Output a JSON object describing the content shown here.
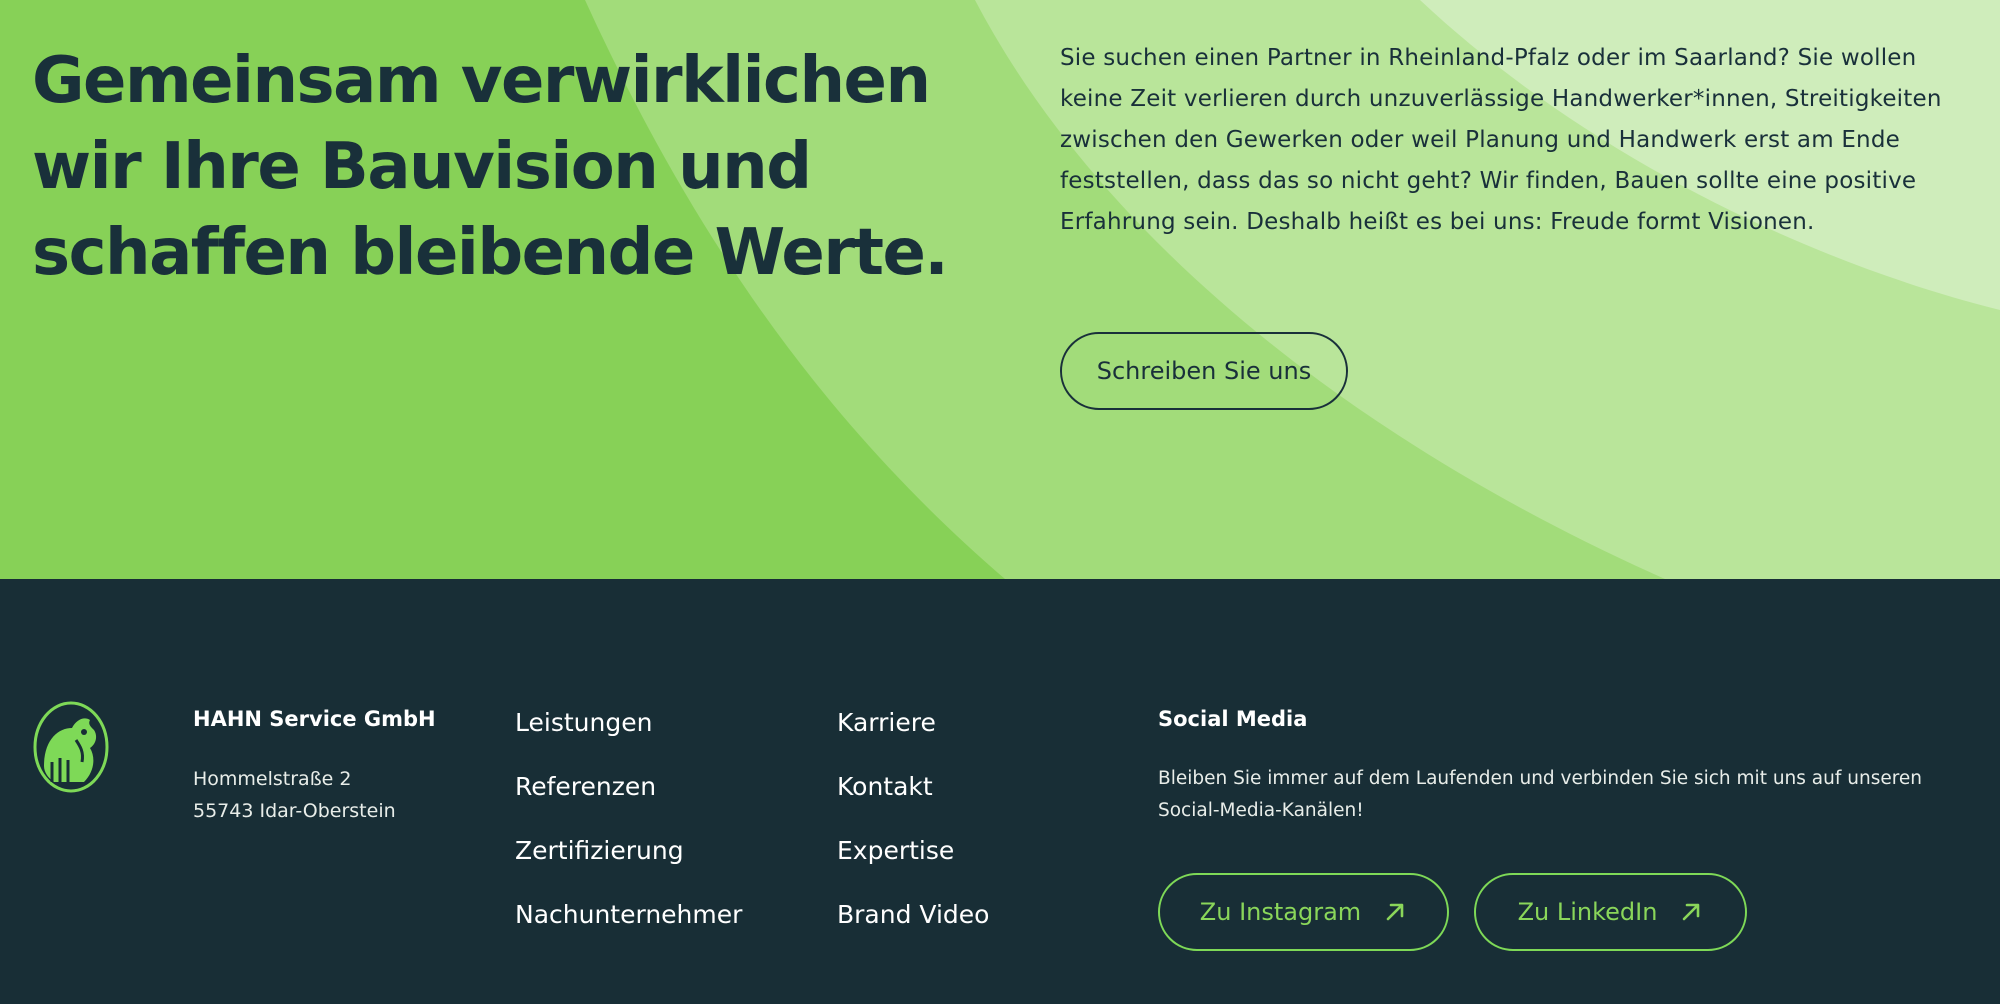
{
  "hero": {
    "title": "Gemeinsam verwirklichen wir Ihre Bauvision und schaffen bleibende Werte.",
    "text": "Sie suchen einen Partner in Rheinland-Pfalz oder im Saarland? Sie wollen keine Zeit verlieren durch unzuverlässige Handwerker*innen, Streitigkeiten zwischen den Gewerken oder weil Planung und Handwerk erst am Ende feststellen, dass das so nicht geht? Wir finden, Bauen sollte eine positive Erfahrung sein. Deshalb heißt es bei uns: Freude formt Visionen.",
    "cta_label": "Schreiben Sie uns"
  },
  "footer": {
    "company": {
      "name": "HAHN Service GmbH",
      "street": "Hommelstraße 2",
      "city": "55743 Idar-Oberstein"
    },
    "nav_col1": [
      "Leistungen",
      "Referenzen",
      "Zertifizierung",
      "Nachunternehmer"
    ],
    "nav_col2": [
      "Karriere",
      "Kontakt",
      "Expertise",
      "Brand Video"
    ],
    "social": {
      "title": "Social Media",
      "text": "Bleiben Sie immer auf dem Laufenden und verbinden Sie sich mit uns auf unseren Social-Media-Kanälen!",
      "instagram_label": "Zu Instagram",
      "linkedin_label": "Zu LinkedIn"
    }
  },
  "colors": {
    "hero_green": "#87d157",
    "hero_green_mid": "#a2dc7a",
    "hero_green_light": "#b9e59a",
    "hero_green_pale": "#cfedbb",
    "dark_navy": "#182e36",
    "accent_green": "#7ed957",
    "text_dark": "#19303a"
  },
  "icons": {
    "logo": "rooster-logo-icon",
    "external": "arrow-up-right-icon"
  }
}
